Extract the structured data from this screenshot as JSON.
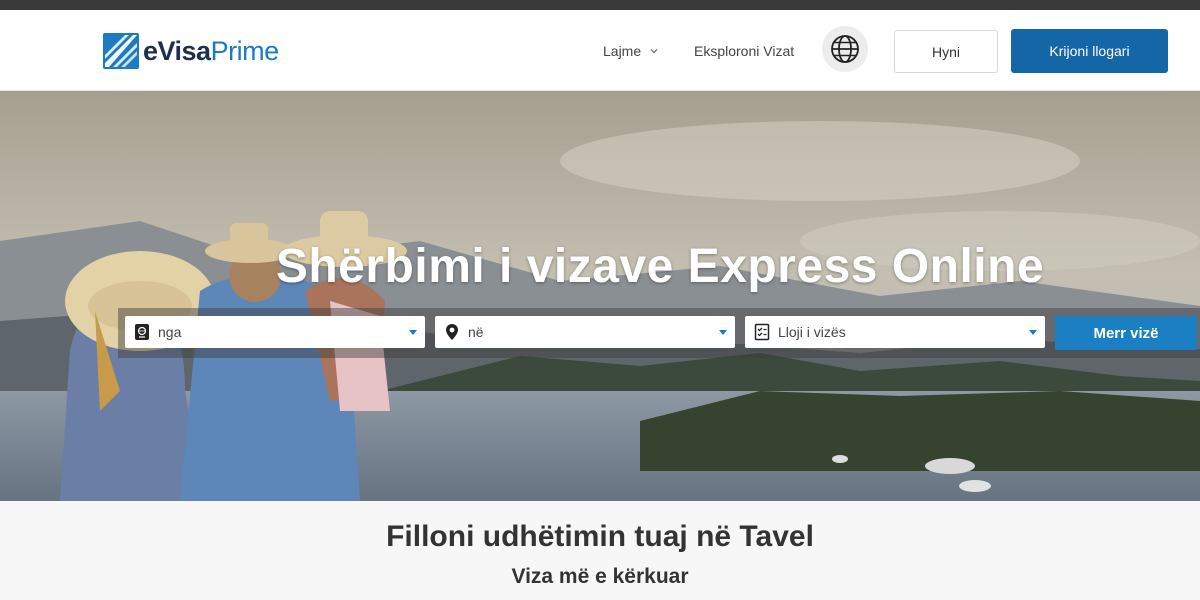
{
  "brand": {
    "name_part1": "eVisa",
    "name_part2": "Prime",
    "color_dark": "#1d2f4d",
    "color_blue": "#1c7bc2",
    "icon": "evisaprime-logo"
  },
  "nav": {
    "news_label": "Lajme",
    "news_icon": "chevron-down-icon",
    "explore_label": "Eksploroni Vizat",
    "language_icon": "globe-icon",
    "login_label": "Hyni",
    "signup_label": "Krijoni llogari",
    "accent": "#1566a6"
  },
  "hero": {
    "title": "Shërbimi i vizave Express Online",
    "search": {
      "from": {
        "value": "nga",
        "icon": "passport-icon"
      },
      "to": {
        "value": "në",
        "icon": "map-pin-icon"
      },
      "visa_type": {
        "value": "Lloji i vizës",
        "icon": "checklist-icon"
      },
      "submit_label": "Merr vizë",
      "submit_color": "#1a7fc3"
    }
  },
  "section": {
    "title": "Filloni udhëtimin tuaj në Tavel",
    "subtitle": "Viza më e kërkuar"
  }
}
